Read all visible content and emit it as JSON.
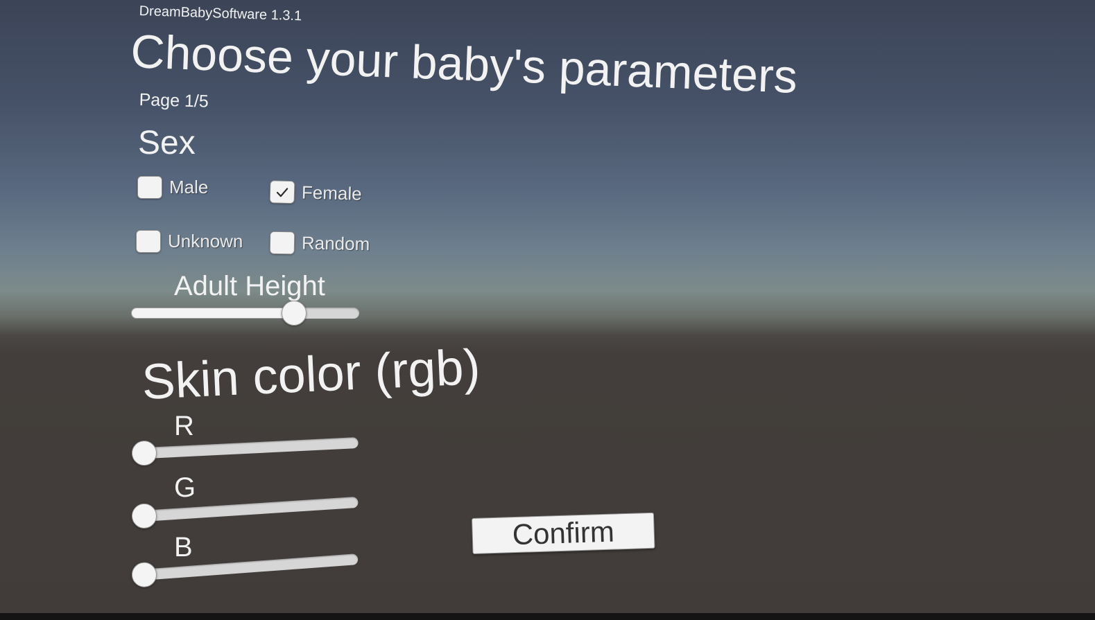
{
  "app": {
    "version_label": "DreamBabySoftware 1.3.1",
    "title": "Choose your baby's parameters",
    "page_indicator": "Page 1/5"
  },
  "sex": {
    "heading": "Sex",
    "options": [
      {
        "label": "Male",
        "checked": false
      },
      {
        "label": "Female",
        "checked": true
      },
      {
        "label": "Unknown",
        "checked": false
      },
      {
        "label": "Random",
        "checked": false
      }
    ]
  },
  "adult_height": {
    "label": "Adult Height",
    "value": 0.74
  },
  "skin_color": {
    "heading": "Skin color (rgb)",
    "channels": [
      {
        "label": "R",
        "value": 0
      },
      {
        "label": "G",
        "value": 0
      },
      {
        "label": "B",
        "value": 0
      }
    ]
  },
  "confirm": {
    "label": "Confirm"
  }
}
